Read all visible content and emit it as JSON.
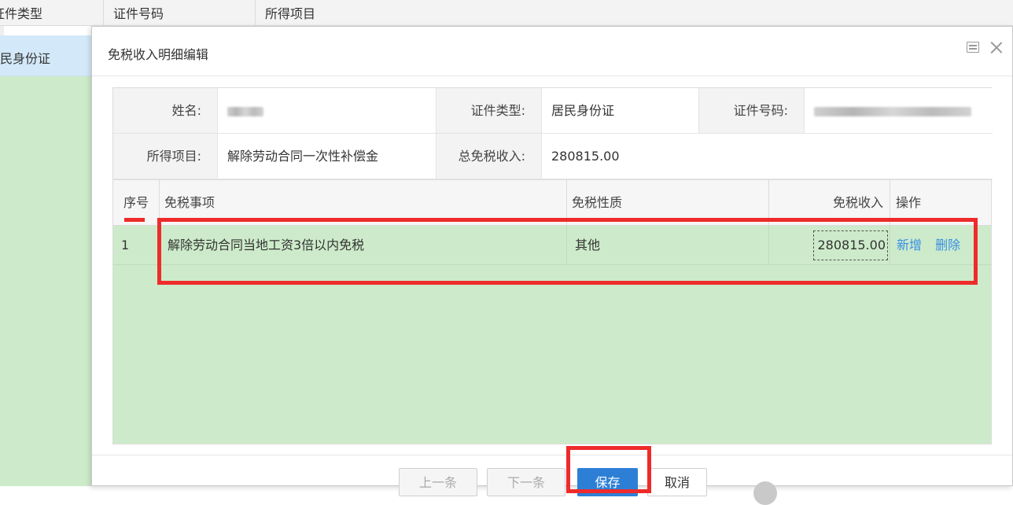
{
  "background_table": {
    "headers": [
      "证件类型",
      "证件号码",
      "所得项目"
    ],
    "selected_row_id_type": "居民身份证"
  },
  "dialog": {
    "title": "免税收入明细编辑"
  },
  "info": {
    "name_label": "姓名:",
    "id_type_label": "证件类型:",
    "id_type_value": "居民身份证",
    "id_no_label": "证件号码:",
    "income_item_label": "所得项目:",
    "income_item_value": "解除劳动合同一次性补偿金",
    "total_label": "总免税收入:",
    "total_value": "280815.00"
  },
  "grid": {
    "headers": {
      "seq": "序号",
      "item": "免税事项",
      "nature": "免税性质",
      "income": "免税收入",
      "ops": "操作"
    },
    "rows": [
      {
        "seq": "1",
        "item": "解除劳动合同当地工资3倍以内免税",
        "nature": "其他",
        "income": "280815.00",
        "add": "新增",
        "delete": "删除"
      }
    ]
  },
  "footer": {
    "prev": "上一条",
    "next": "下一条",
    "save": "保存",
    "cancel": "取消"
  },
  "colors": {
    "row_green": "#cdebca",
    "annotation_red": "#ee2b2b",
    "primary_blue": "#2d7fd6",
    "link_blue": "#3a8ee6"
  }
}
